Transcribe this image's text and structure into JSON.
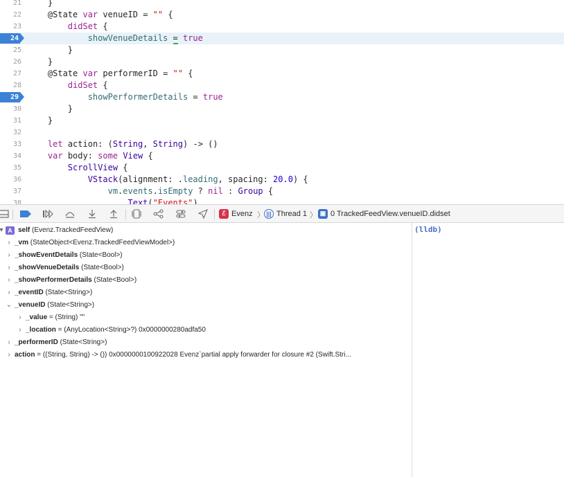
{
  "editor": {
    "lines": [
      {
        "num": "21",
        "tokens": [
          {
            "t": "    }",
            "c": ""
          }
        ]
      },
      {
        "num": "22",
        "tokens": [
          {
            "t": "    @State ",
            "c": ""
          },
          {
            "t": "var",
            "c": "kw"
          },
          {
            "t": " venueID = ",
            "c": ""
          },
          {
            "t": "\"\"",
            "c": "str"
          },
          {
            "t": " {",
            "c": ""
          }
        ]
      },
      {
        "num": "23",
        "tokens": [
          {
            "t": "        ",
            "c": ""
          },
          {
            "t": "didSet",
            "c": "kw"
          },
          {
            "t": " {",
            "c": ""
          }
        ]
      },
      {
        "num": "24",
        "breakpoint": true,
        "current": true,
        "tokens": [
          {
            "t": "            showVenueDetails ",
            "c": "fn"
          },
          {
            "t": "=",
            "c": "caret"
          },
          {
            "t": " ",
            "c": ""
          },
          {
            "t": "true",
            "c": "kw"
          }
        ]
      },
      {
        "num": "25",
        "tokens": [
          {
            "t": "        }",
            "c": ""
          }
        ]
      },
      {
        "num": "26",
        "tokens": [
          {
            "t": "    }",
            "c": ""
          }
        ]
      },
      {
        "num": "27",
        "tokens": [
          {
            "t": "    @State ",
            "c": ""
          },
          {
            "t": "var",
            "c": "kw"
          },
          {
            "t": " performerID = ",
            "c": ""
          },
          {
            "t": "\"\"",
            "c": "str"
          },
          {
            "t": " {",
            "c": ""
          }
        ]
      },
      {
        "num": "28",
        "tokens": [
          {
            "t": "        ",
            "c": ""
          },
          {
            "t": "didSet",
            "c": "kw"
          },
          {
            "t": " {",
            "c": ""
          }
        ]
      },
      {
        "num": "29",
        "breakpoint": true,
        "tokens": [
          {
            "t": "            showPerformerDetails",
            "c": "fn"
          },
          {
            "t": " = ",
            "c": ""
          },
          {
            "t": "true",
            "c": "kw"
          }
        ]
      },
      {
        "num": "30",
        "tokens": [
          {
            "t": "        }",
            "c": ""
          }
        ]
      },
      {
        "num": "31",
        "tokens": [
          {
            "t": "    }",
            "c": ""
          }
        ]
      },
      {
        "num": "32",
        "tokens": [
          {
            "t": "",
            "c": ""
          }
        ]
      },
      {
        "num": "33",
        "tokens": [
          {
            "t": "    ",
            "c": ""
          },
          {
            "t": "let",
            "c": "kw"
          },
          {
            "t": " action: (",
            "c": ""
          },
          {
            "t": "String",
            "c": "tp"
          },
          {
            "t": ", ",
            "c": ""
          },
          {
            "t": "String",
            "c": "tp"
          },
          {
            "t": ") -> ()",
            "c": ""
          }
        ]
      },
      {
        "num": "34",
        "tokens": [
          {
            "t": "    ",
            "c": ""
          },
          {
            "t": "var",
            "c": "kw"
          },
          {
            "t": " body: ",
            "c": ""
          },
          {
            "t": "some",
            "c": "kw"
          },
          {
            "t": " ",
            "c": ""
          },
          {
            "t": "View",
            "c": "tp"
          },
          {
            "t": " {",
            "c": ""
          }
        ]
      },
      {
        "num": "35",
        "tokens": [
          {
            "t": "        ",
            "c": ""
          },
          {
            "t": "ScrollView",
            "c": "tp"
          },
          {
            "t": " {",
            "c": ""
          }
        ]
      },
      {
        "num": "36",
        "tokens": [
          {
            "t": "            ",
            "c": ""
          },
          {
            "t": "VStack",
            "c": "tp"
          },
          {
            "t": "(alignment: .",
            "c": ""
          },
          {
            "t": "leading",
            "c": "fn"
          },
          {
            "t": ", spacing: ",
            "c": ""
          },
          {
            "t": "20.0",
            "c": "num"
          },
          {
            "t": ") {",
            "c": ""
          }
        ]
      },
      {
        "num": "37",
        "tokens": [
          {
            "t": "                ",
            "c": ""
          },
          {
            "t": "vm",
            "c": "fn"
          },
          {
            "t": ".",
            "c": ""
          },
          {
            "t": "events",
            "c": "fn"
          },
          {
            "t": ".",
            "c": ""
          },
          {
            "t": "isEmpty",
            "c": "fn"
          },
          {
            "t": " ? ",
            "c": ""
          },
          {
            "t": "nil",
            "c": "kw"
          },
          {
            "t": " : ",
            "c": ""
          },
          {
            "t": "Group",
            "c": "tp"
          },
          {
            "t": " {",
            "c": ""
          }
        ]
      },
      {
        "num": "38",
        "tokens": [
          {
            "t": "                    ",
            "c": ""
          },
          {
            "t": "Text",
            "c": "tp"
          },
          {
            "t": "(",
            "c": ""
          },
          {
            "t": "\"Events\"",
            "c": "str"
          },
          {
            "t": ")",
            "c": ""
          }
        ]
      }
    ]
  },
  "debugbar": {
    "scheme": "Evenz",
    "thread": "Thread 1",
    "frame": "0 TrackedFeedView.venueID.didset",
    "icons": [
      "hide-debug-area-icon",
      "breakpoints-toggle-icon",
      "continue-icon",
      "step-over-icon",
      "step-into-icon",
      "step-out-icon",
      "view-debugger-icon",
      "memory-graph-icon",
      "environment-overrides-icon",
      "simulate-location-icon"
    ]
  },
  "variables": [
    {
      "indent": 0,
      "expander": "",
      "badge": "A",
      "name": "self",
      "rest": " (Evenz.TrackedFeedView)"
    },
    {
      "indent": 1,
      "expander": "›",
      "name": "_vm",
      "rest": " (StateObject<Evenz.TrackedFeedViewModel>)"
    },
    {
      "indent": 1,
      "expander": "›",
      "name": "_showEventDetails",
      "rest": " (State<Bool>)"
    },
    {
      "indent": 1,
      "expander": "›",
      "name": "_showVenueDetails",
      "rest": " (State<Bool>)"
    },
    {
      "indent": 1,
      "expander": "›",
      "name": "_showPerformerDetails",
      "rest": " (State<Bool>)"
    },
    {
      "indent": 1,
      "expander": "›",
      "name": "_eventID",
      "rest": " (State<String>)"
    },
    {
      "indent": 1,
      "expander": "⌄",
      "name": "_venueID",
      "rest": " (State<String>)"
    },
    {
      "indent": 2,
      "expander": "›",
      "name": "_value",
      "rest": " = (String) \"\""
    },
    {
      "indent": 2,
      "expander": "›",
      "name": "_location",
      "rest": " = (AnyLocation<String>?) 0x0000000280adfa50"
    },
    {
      "indent": 1,
      "expander": "›",
      "name": "_performerID",
      "rest": " (State<String>)"
    },
    {
      "indent": 1,
      "expander": "›",
      "name": "action",
      "rest": " = ((String, String) -> ()) 0x0000000100922028 Evenz`partial apply forwarder for closure #2 (Swift.Stri..."
    }
  ],
  "console": {
    "prompt": "(lldb)"
  },
  "colors": {
    "breakpoint": "#3b82d6",
    "current_line": "#e8f2f8",
    "keyword": "#9b2393",
    "type": "#3900a0",
    "string": "#c41a16"
  }
}
